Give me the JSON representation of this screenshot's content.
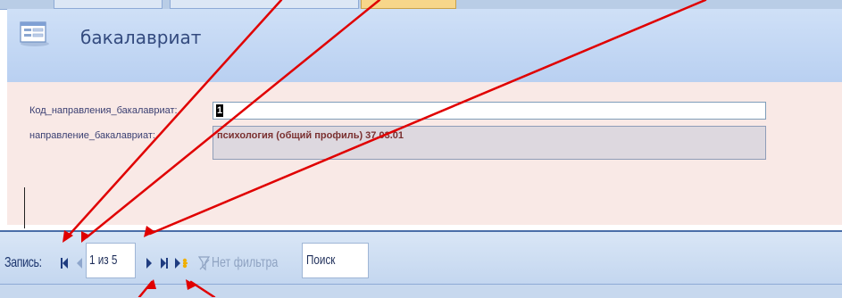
{
  "form": {
    "title": "бакалавриат"
  },
  "fields": {
    "code_label": "Код_направления_бакалавриат:",
    "code_value": "1",
    "direction_label": "направление_бакалавриат:",
    "direction_value": "психология (общий профиль) 37.03.01"
  },
  "navigation": {
    "label": "Запись:",
    "record": "1 из 5",
    "filter": "Нет фильтра",
    "search": "Поиск"
  },
  "icons": {
    "form": "form-icon",
    "first": "first-record-icon",
    "previous": "previous-record-icon",
    "next": "next-record-icon",
    "last": "last-record-icon",
    "new": "new-record-icon",
    "filter": "filter-icon"
  },
  "colors": {
    "arrow": "#e00000",
    "header": "#cfe0f7",
    "detail": "#f9e9e6"
  }
}
